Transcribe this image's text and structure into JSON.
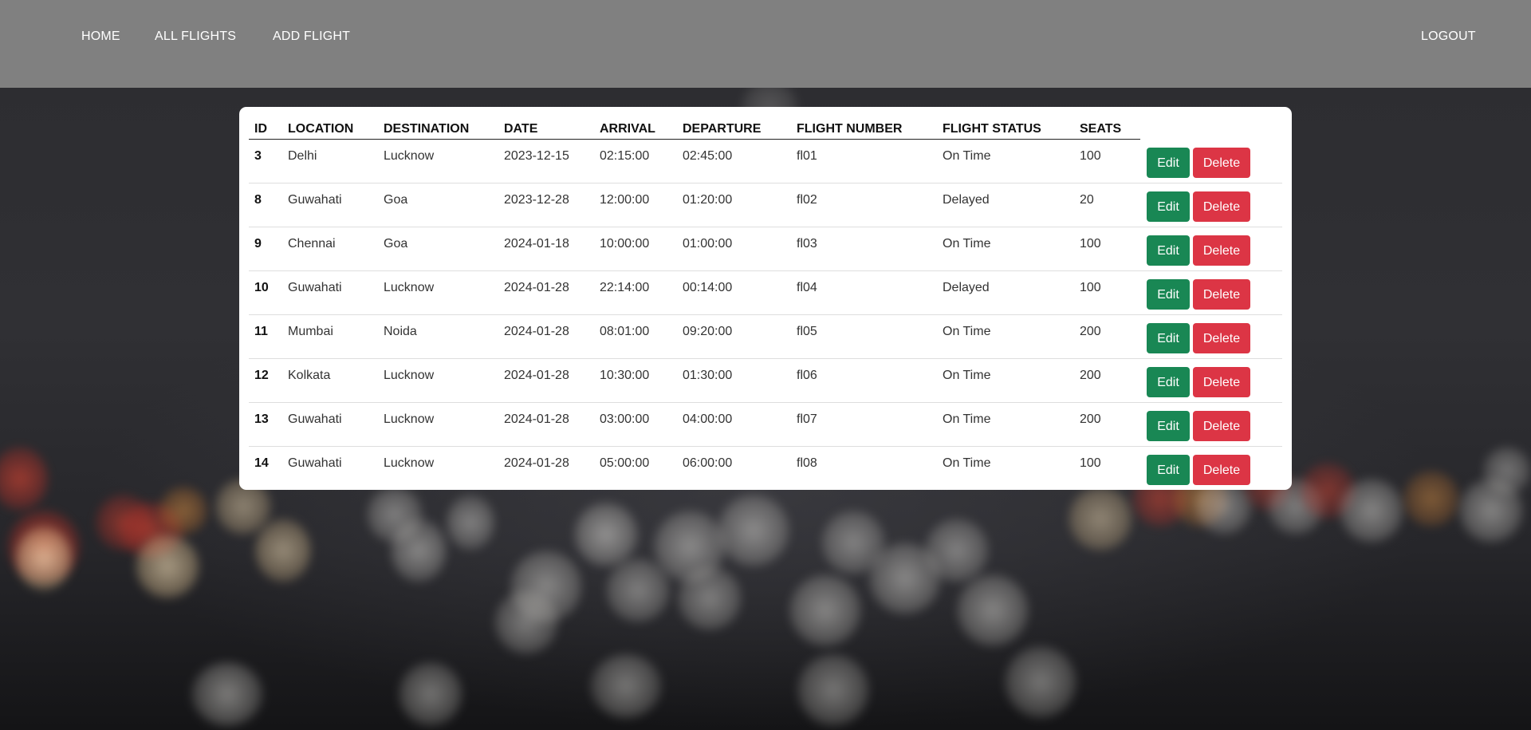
{
  "nav": {
    "home": "HOME",
    "all_flights": "ALL FLIGHTS",
    "add_flight": "ADD FLIGHT",
    "logout": "LOGOUT"
  },
  "colors": {
    "navbar": "#808080",
    "edit_button": "#198754",
    "delete_button": "#dc3545"
  },
  "table": {
    "headers": [
      "ID",
      "LOCATION",
      "DESTINATION",
      "DATE",
      "ARRIVAL",
      "DEPARTURE",
      "FLIGHT NUMBER",
      "FLIGHT STATUS",
      "SEATS"
    ],
    "edit_label": "Edit",
    "delete_label": "Delete",
    "rows": [
      [
        "3",
        "Delhi",
        "Lucknow",
        "2023-12-15",
        "02:15:00",
        "02:45:00",
        "fl01",
        "On Time",
        "100"
      ],
      [
        "8",
        "Guwahati",
        "Goa",
        "2023-12-28",
        "12:00:00",
        "01:20:00",
        "fl02",
        "Delayed",
        "20"
      ],
      [
        "9",
        "Chennai",
        "Goa",
        "2024-01-18",
        "10:00:00",
        "01:00:00",
        "fl03",
        "On Time",
        "100"
      ],
      [
        "10",
        "Guwahati",
        "Lucknow",
        "2024-01-28",
        "22:14:00",
        "00:14:00",
        "fl04",
        "Delayed",
        "100"
      ],
      [
        "11",
        "Mumbai",
        "Noida",
        "2024-01-28",
        "08:01:00",
        "09:20:00",
        "fl05",
        "On Time",
        "200"
      ],
      [
        "12",
        "Kolkata",
        "Lucknow",
        "2024-01-28",
        "10:30:00",
        "01:30:00",
        "fl06",
        "On Time",
        "200"
      ],
      [
        "13",
        "Guwahati",
        "Lucknow",
        "2024-01-28",
        "03:00:00",
        "04:00:00",
        "fl07",
        "On Time",
        "200"
      ],
      [
        "14",
        "Guwahati",
        "Lucknow",
        "2024-01-28",
        "05:00:00",
        "06:00:00",
        "fl08",
        "On Time",
        "100"
      ]
    ]
  }
}
